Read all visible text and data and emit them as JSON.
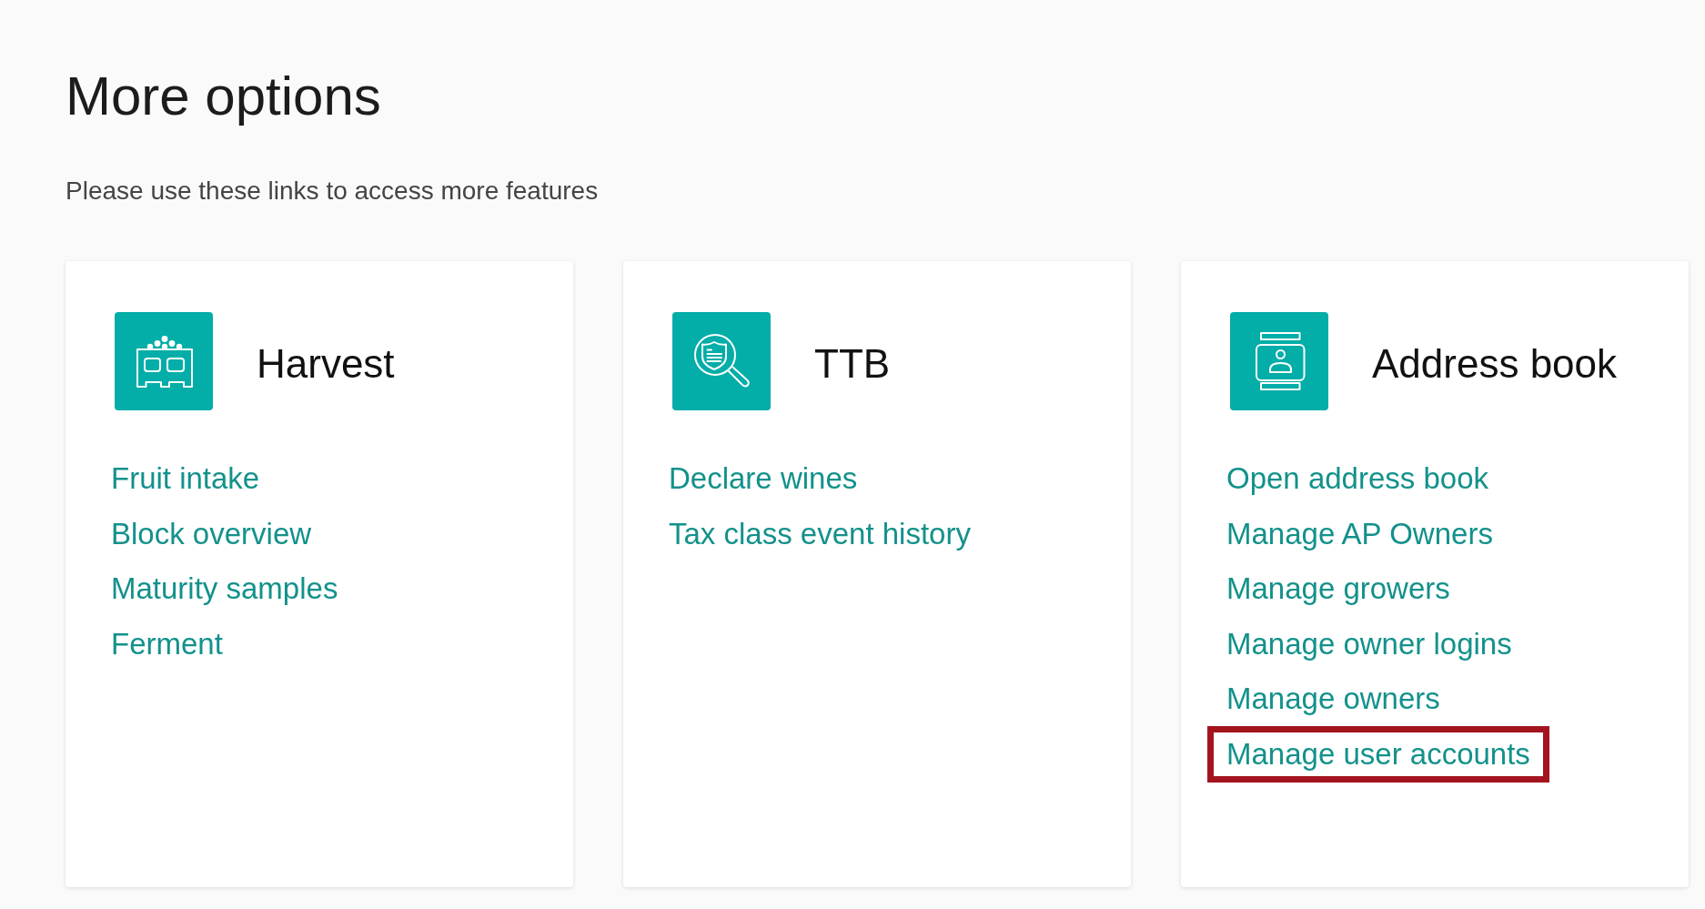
{
  "title": "More options",
  "subtitle": "Please use these links to access more features",
  "sections": [
    {
      "heading": "Harvest",
      "links": [
        {
          "label": "Fruit intake",
          "highlighted": false
        },
        {
          "label": "Block overview",
          "highlighted": false
        },
        {
          "label": "Maturity samples",
          "highlighted": false
        },
        {
          "label": "Ferment",
          "highlighted": false
        }
      ]
    },
    {
      "heading": "TTB",
      "links": [
        {
          "label": "Declare wines",
          "highlighted": false
        },
        {
          "label": "Tax class event history",
          "highlighted": false
        }
      ]
    },
    {
      "heading": "Address book",
      "links": [
        {
          "label": "Open address book",
          "highlighted": false
        },
        {
          "label": "Manage AP Owners",
          "highlighted": false
        },
        {
          "label": "Manage growers",
          "highlighted": false
        },
        {
          "label": "Manage owner logins",
          "highlighted": false
        },
        {
          "label": "Manage owners",
          "highlighted": false
        },
        {
          "label": "Manage user accounts",
          "highlighted": true
        }
      ]
    }
  ]
}
